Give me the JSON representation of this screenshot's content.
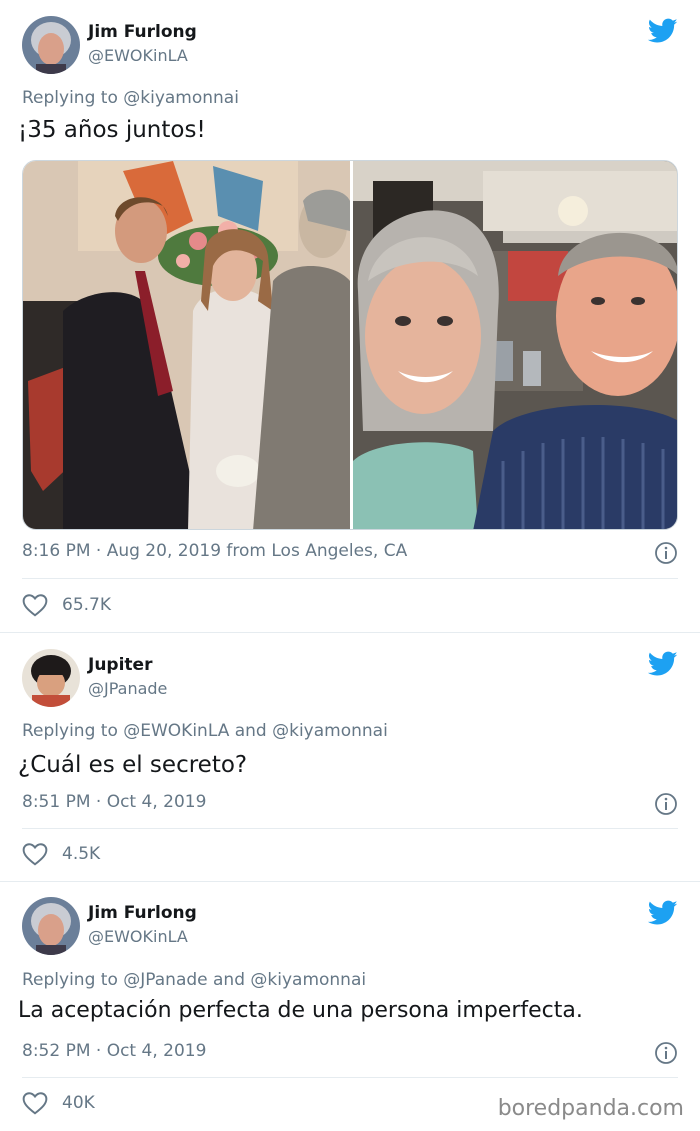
{
  "tweets": [
    {
      "name": "Jim Furlong",
      "handle": "@EWOKinLA",
      "reply_prefix": "Replying to",
      "reply_mentions": "@kiyamonnai",
      "text": "¡35 años juntos!",
      "meta": "8:16 PM · Aug 20, 2019 from Los Angeles, CA",
      "likes": "65.7K"
    },
    {
      "name": "Jupiter",
      "handle": "@JPanade",
      "reply_prefix": "Replying to",
      "reply_mentions": "@EWOKinLA and @kiyamonnai",
      "text": "¿Cuál es el secreto?",
      "meta": "8:51 PM · Oct 4, 2019",
      "likes": "4.5K"
    },
    {
      "name": "Jim Furlong",
      "handle": "@EWOKinLA",
      "reply_prefix": "Replying to",
      "reply_mentions": "@JPanade and @kiyamonnai",
      "text": "La aceptación perfecta de una persona imperfecta.",
      "meta": "8:52 PM · Oct 4, 2019",
      "likes": "40K"
    }
  ],
  "watermark": "boredpanda.com",
  "colors": {
    "twitter_blue": "#1da1f2",
    "secondary_text": "#657786",
    "primary_text": "#14171a",
    "divider": "#e6ecf0"
  },
  "icons": {
    "brand": "twitter-bird-icon",
    "info": "info-icon",
    "like": "heart-icon"
  }
}
